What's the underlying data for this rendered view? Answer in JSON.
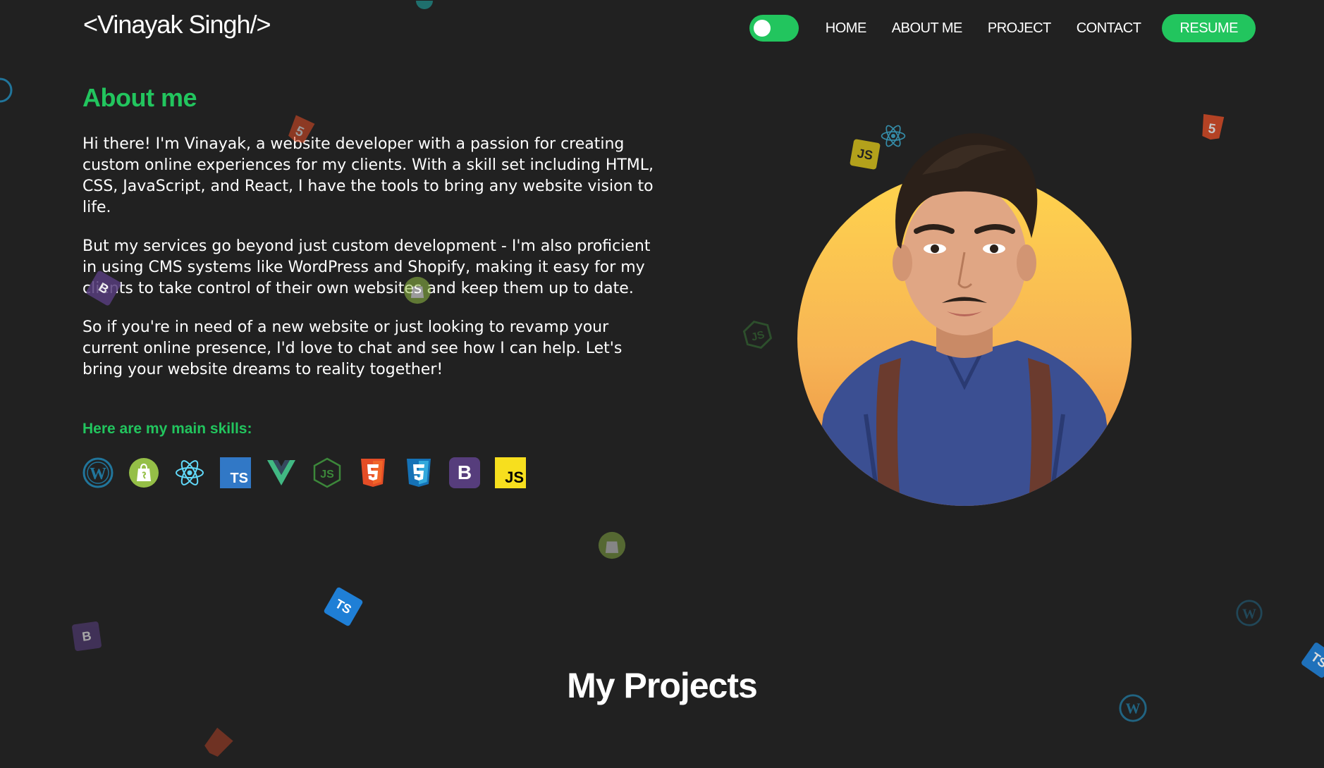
{
  "header": {
    "logo": "<Vinayak Singh/>",
    "theme_toggle": "on",
    "nav": [
      "HOME",
      "ABOUT ME",
      "PROJECT",
      "CONTACT"
    ],
    "resume_label": "RESUME"
  },
  "about": {
    "title": "About me",
    "paragraphs": [
      "Hi there! I'm Vinayak, a website developer with a passion for creating custom online experiences for my clients. With a skill set including HTML, CSS, JavaScript, and React, I have the tools to bring any website vision to life.",
      "But my services go beyond just custom development - I'm also proficient in using CMS systems like WordPress and Shopify, making it easy for my clients to take control of their own websites and keep them up to date.",
      "So if you're in need of a new website or just looking to revamp your current online presence, I'd love to chat and see how I can help. Let's bring your website dreams to reality together!"
    ],
    "skills_title": "Here are my main skills:",
    "skills": [
      {
        "icon": "wordpress-icon",
        "color": "#21759b"
      },
      {
        "icon": "shopify-icon",
        "color": "#95bf47"
      },
      {
        "icon": "react-icon",
        "color": "#61dafb"
      },
      {
        "icon": "typescript-icon",
        "color": "#3178c6",
        "text": "TS"
      },
      {
        "icon": "vue-icon",
        "color": "#41b883"
      },
      {
        "icon": "nodejs-icon",
        "color": "#3c873a"
      },
      {
        "icon": "html5-icon",
        "color": "#e44d26"
      },
      {
        "icon": "css3-icon",
        "color": "#1572b6"
      },
      {
        "icon": "bootstrap-icon",
        "color": "#563d7c",
        "text": "B"
      },
      {
        "icon": "javascript-icon",
        "color": "#f7df1e",
        "text": "JS"
      }
    ]
  },
  "projects": {
    "title": "My Projects"
  },
  "colors": {
    "background": "#212121",
    "accent": "#22c55e",
    "text": "#ffffff"
  }
}
